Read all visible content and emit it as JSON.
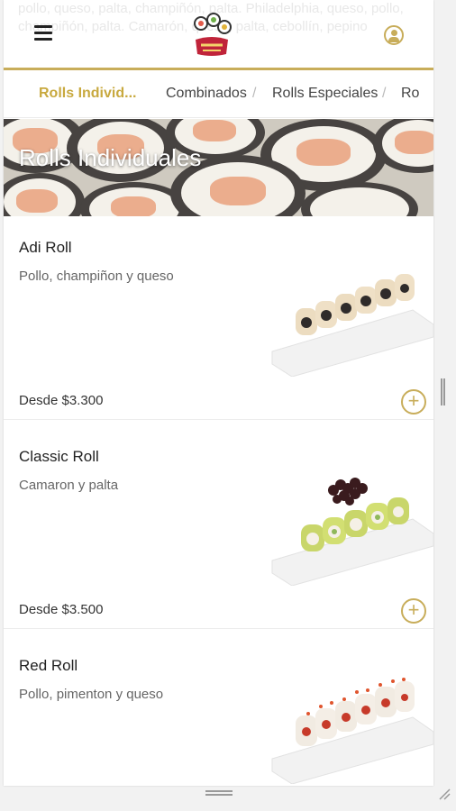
{
  "header": {
    "background_text": "pollo, queso, palta, champiñón, palta. Philadelphia, queso, pollo, champiñón, palta. Camarón, queso, palta, cebollín, pepino",
    "logo_icon": "sushi-logo-icon",
    "menu_icon": "hamburger-menu-icon",
    "profile_icon": "user-profile-icon"
  },
  "tabs": [
    {
      "label": "Rolls Individ...",
      "active": true
    },
    {
      "label": "Combinados",
      "active": false
    },
    {
      "label": "Rolls Especiales",
      "active": false
    },
    {
      "label": "Ro",
      "active": false
    }
  ],
  "tab_separator": "/",
  "banner": {
    "title": "Rolls Individuales"
  },
  "products": [
    {
      "name": "Adi Roll",
      "description": "Pollo, champiñon y queso",
      "price": "Desde $3.300"
    },
    {
      "name": "Classic Roll",
      "description": "Camaron y palta",
      "price": "Desde $3.500"
    },
    {
      "name": "Red Roll",
      "description": "Pollo, pimenton y queso",
      "price": ""
    }
  ],
  "add_button_symbol": "+",
  "colors": {
    "accent": "#c8ad5a",
    "active_tab": "#c8a93f",
    "text": "#222222",
    "muted": "#666666"
  }
}
